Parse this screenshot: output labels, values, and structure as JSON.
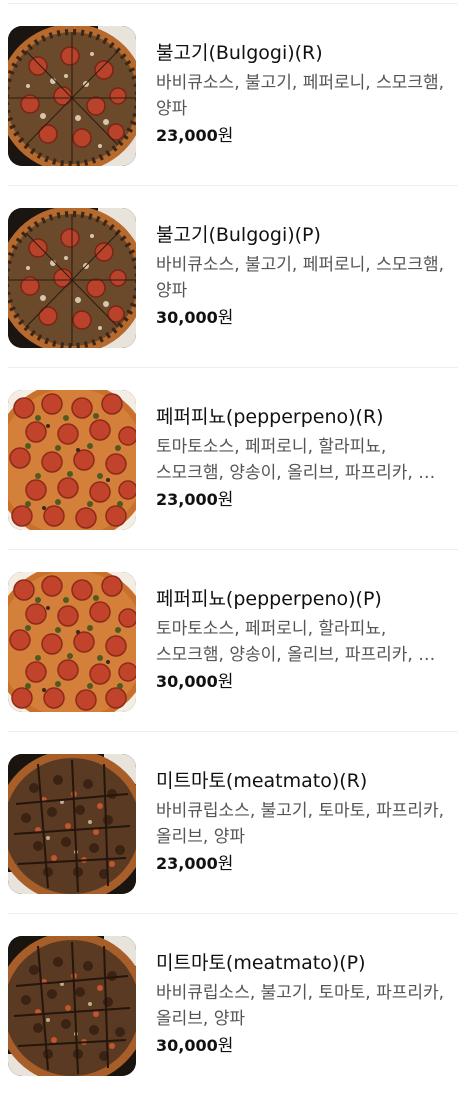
{
  "menu": {
    "items": [
      {
        "name": "불고기(Bulgogi)(R)",
        "description": "바비큐소스, 불고기, 페퍼로니, 스모크햄, 양파",
        "price": "23,000",
        "currency": "원",
        "image_icon": "pizza-bulgogi-image"
      },
      {
        "name": "불고기(Bulgogi)(P)",
        "description": "바비큐소스, 불고기, 페퍼로니, 스모크햄, 양파",
        "price": "30,000",
        "currency": "원",
        "image_icon": "pizza-bulgogi-image"
      },
      {
        "name": "페퍼피뇨(pepperpeno)(R)",
        "description": "토마토소스, 페퍼로니, 할라피뇨, 스모크햄, 양송이, 올리브, 파프리카, …",
        "price": "23,000",
        "currency": "원",
        "image_icon": "pizza-pepperpeno-image"
      },
      {
        "name": "페퍼피뇨(pepperpeno)(P)",
        "description": "토마토소스, 페퍼로니, 할라피뇨, 스모크햄, 양송이, 올리브, 파프리카, …",
        "price": "30,000",
        "currency": "원",
        "image_icon": "pizza-pepperpeno-image"
      },
      {
        "name": "미트마토(meatmato)(R)",
        "description": "바비큐립소스, 불고기, 토마토, 파프리카, 올리브, 양파",
        "price": "23,000",
        "currency": "원",
        "image_icon": "pizza-meatmato-image"
      },
      {
        "name": "미트마토(meatmato)(P)",
        "description": "바비큐립소스, 불고기, 토마토, 파프리카, 올리브, 양파",
        "price": "30,000",
        "currency": "원",
        "image_icon": "pizza-meatmato-image"
      }
    ]
  },
  "colors": {
    "text_primary": "#111111",
    "text_secondary": "#555555",
    "divider": "#eeeeee"
  }
}
